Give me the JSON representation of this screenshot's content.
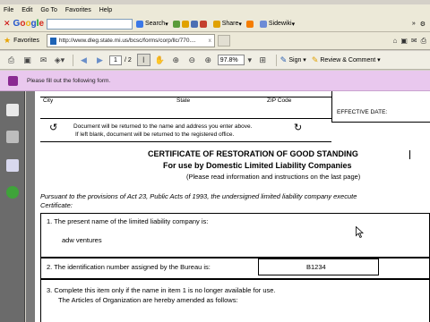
{
  "menubar": {
    "items": [
      "File",
      "Edit",
      "Go To",
      "Favorites",
      "Help"
    ]
  },
  "google_toolbar": {
    "logo": "Google",
    "search_button": "Search",
    "share_button": "Share",
    "sidewiki_button": "Sidewiki"
  },
  "address_row": {
    "favorites_label": "Favorites",
    "tab_url": "http://www.dleg.state.mi.us/bcsc/forms/corp/llc/770...."
  },
  "acrobat_toolbar": {
    "page_current": "1",
    "page_total": "/ 2",
    "zoom": "97.8%",
    "sign_label": "Sign",
    "review_label": "Review & Comment"
  },
  "message_bar": {
    "text": "Please fill out the following form."
  },
  "document": {
    "label_city": "City",
    "label_state": "State",
    "label_zip": "ZIP Code",
    "label_effective_date": "EFFECTIVE DATE:",
    "return_note_1": "Document will be returned to the name and address you enter above.",
    "return_note_2": "If left blank, document will be returned to the registered office.",
    "title": "CERTIFICATE OF RESTORATION OF GOOD STANDING",
    "subtitle": "For use by Domestic Limited Liability Companies",
    "read_note": "(Please read information and instructions on the last page)",
    "pursuant_1": "Pursuant to the provisions of Act 23, Public Acts of 1993, the undersigned limited liability company execute",
    "pursuant_2": "Certificate:",
    "item1_text": "1.  The present name of the limited liability company is:",
    "item1_value": "adw ventures",
    "item2_text": "2.  The identification number assigned by the Bureau is:",
    "item2_value": "B1234",
    "item3_text": "3.  Complete this item only if the name in item 1 is no longer available for use.",
    "item3_text2": "The Articles of Organization are hereby amended as follows:"
  },
  "colors": {
    "message_bar_bg": "#e9c8ee",
    "nav_pane_bg": "#6b6b6b",
    "toolbar_bg": "#ece9d8"
  }
}
